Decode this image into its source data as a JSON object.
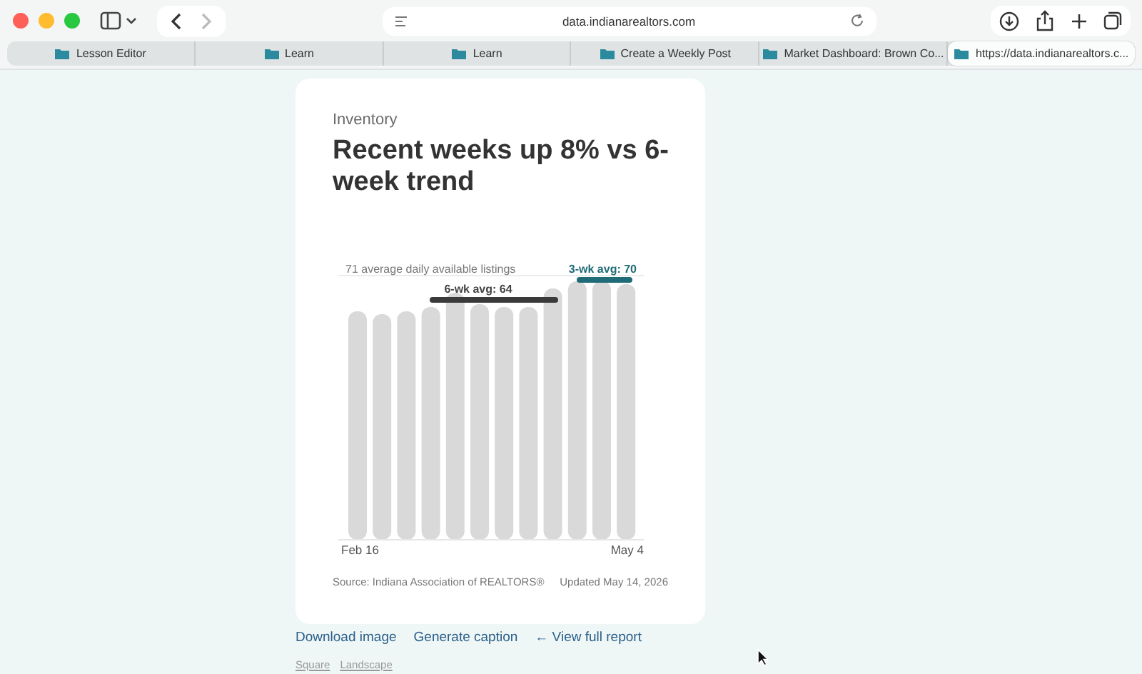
{
  "browser": {
    "url": "data.indianarealtors.com",
    "tabs": [
      {
        "label": "Lesson Editor",
        "selected": false
      },
      {
        "label": "Learn",
        "selected": false
      },
      {
        "label": "Learn",
        "selected": false
      },
      {
        "label": "Create a Weekly Post",
        "selected": false
      },
      {
        "label": "Market Dashboard: Brown Co...",
        "selected": false
      },
      {
        "label": "https://data.indianarealtors.c...",
        "selected": true
      }
    ]
  },
  "card": {
    "eyebrow": "Inventory",
    "title": "Recent weeks up 8% vs 6-week trend",
    "chart": {
      "reference_label": "71 average daily available listings",
      "recent_avg_label": "3-wk avg: 70",
      "trend_avg_label": "6-wk avg: 64",
      "x_start": "Feb 16",
      "x_end": "May 4"
    },
    "source": "Source: Indiana Association of REALTORS®",
    "updated": "Updated May 14, 2026"
  },
  "actions": [
    "Download image",
    "Generate caption",
    "← View full report"
  ],
  "formats": [
    "Square",
    "Landscape"
  ]
}
